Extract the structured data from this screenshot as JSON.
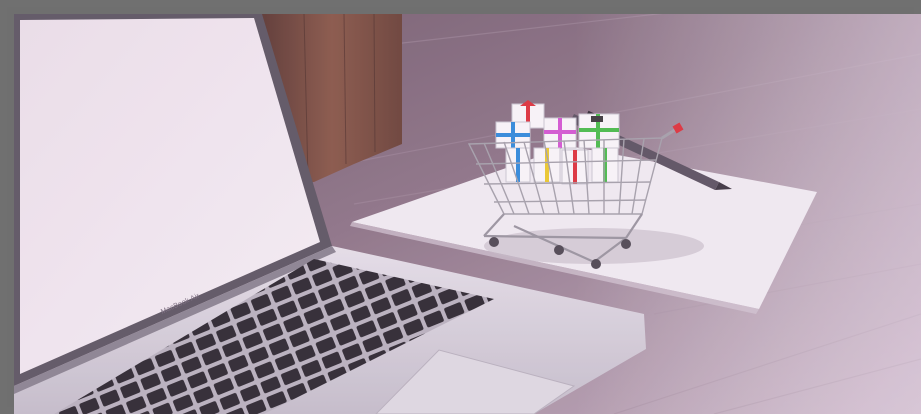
{
  "photo": {
    "laptop_brand_text": "MacBook Air",
    "colors": {
      "frame": "#707070",
      "desk_wood": "#8d7684",
      "desk_highlight": "#e9dfea",
      "laptop_screen": "#f8f2f6",
      "laptop_body": "#d9d6dd",
      "keyboard_keys": "#2b292e",
      "paper": "#f7f4f8",
      "post_wood": "#7a4e3f",
      "gift_red": "#e2343a",
      "gift_blue": "#2f8fe0",
      "gift_magenta": "#d85ad6",
      "gift_green": "#49c34a",
      "gift_yellow": "#f1d12b"
    }
  }
}
